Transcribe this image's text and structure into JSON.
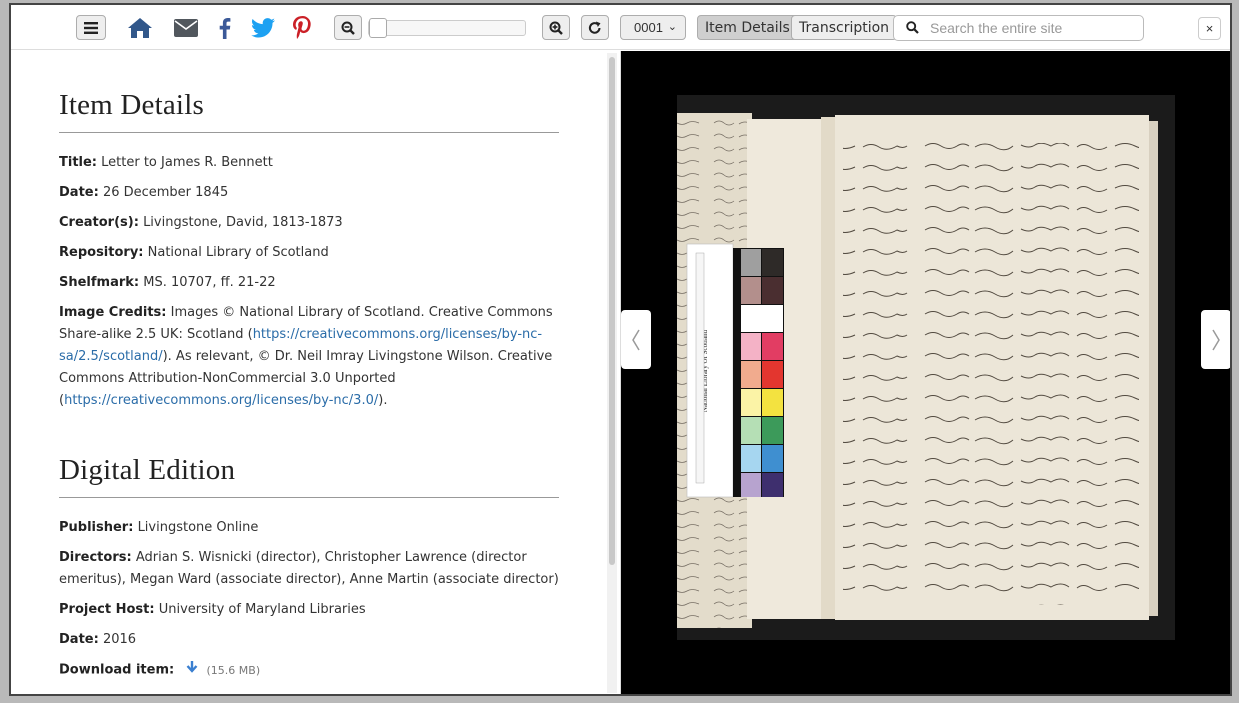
{
  "toolbar": {
    "icons": [
      "menu-icon",
      "home-icon",
      "envelope-icon",
      "facebook-icon",
      "twitter-icon",
      "pinterest-icon",
      "zoom-out-icon",
      "zoom-in-icon",
      "rotate-icon"
    ],
    "page_select": "0001",
    "item_details_label": "Item Details",
    "transcription_label": "Transcription",
    "search_placeholder": "Search the entire site",
    "close_label": "×",
    "zoom_level": 0
  },
  "item_details": {
    "heading": "Item Details",
    "title_label": "Title:",
    "title_value": "Letter to James R. Bennett",
    "date_label": "Date:",
    "date_value": "26 December 1845",
    "creator_label": "Creator(s):",
    "creator_value": "Livingstone, David, 1813-1873",
    "repository_label": "Repository:",
    "repository_value": "National Library of Scotland",
    "shelfmark_label": "Shelfmark:",
    "shelfmark_value": "MS. 10707, ff. 21-22",
    "credits_label": "Image Credits:",
    "credits_text1": "Images © National Library of Scotland. Creative Commons Share-alike 2.5 UK: Scotland (",
    "credits_link1": "https://creativecommons.org/licenses/by-nc-sa/2.5/scotland/",
    "credits_text2": "). As relevant, © Dr. Neil Imray Livingstone Wilson. Creative Commons Attribution-NonCommercial 3.0 Unported (",
    "credits_link2": "https://creativecommons.org/licenses/by-nc/3.0/",
    "credits_text3": ")."
  },
  "digital_edition": {
    "heading": "Digital Edition",
    "publisher_label": "Publisher:",
    "publisher_value": "Livingstone Online",
    "directors_label": "Directors:",
    "directors_value": "Adrian S. Wisnicki (director), Christopher Lawrence (director emeritus), Megan Ward (associate director), Anne Martin (associate director)",
    "host_label": "Project Host:",
    "host_value": "University of Maryland Libraries",
    "date_label": "Date:",
    "date_value": "2016",
    "download_label": "Download item:",
    "download_size": "(15.6 MB)"
  },
  "viewer": {
    "color_card_text": "National Library Of Scotland",
    "prev_icon": "chevron-left-icon",
    "next_icon": "chevron-right-icon"
  },
  "colors": {
    "home": "#31578a",
    "envelope": "#51575d",
    "facebook": "#3b5998",
    "twitter": "#1da1f2",
    "pinterest": "#cb2027",
    "link": "#2a6ca8",
    "download_arrow": "#3a7fd0"
  }
}
